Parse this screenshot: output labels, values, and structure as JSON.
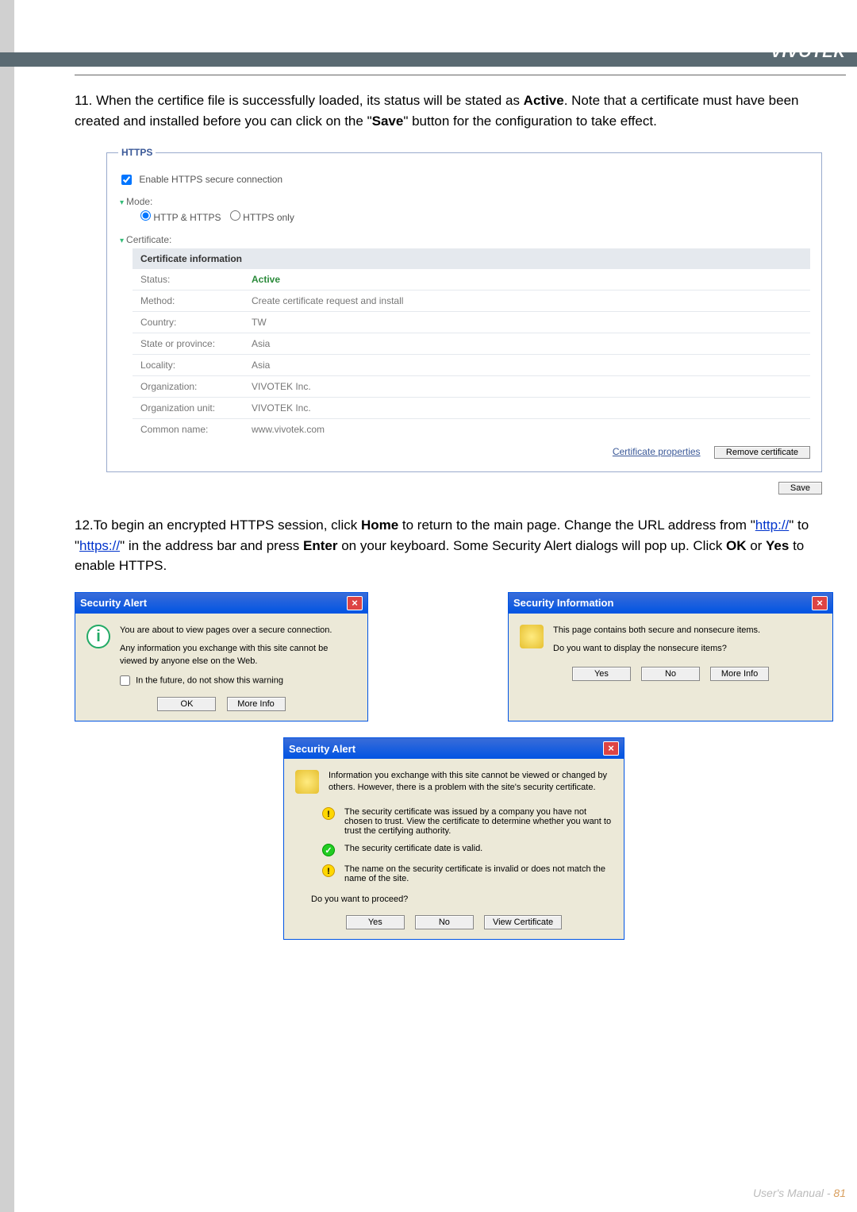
{
  "brand": "VIVOTEK",
  "step11": {
    "prefix": "11. When the certifice file is successfully loaded, its status will be stated as ",
    "active": "Active",
    "mid": ". Note that a certificate must have been created and installed before you can click on the \"",
    "save": "Save",
    "suffix": "\" button for the configuration to take effect."
  },
  "https_panel": {
    "legend": "HTTPS",
    "enable_label": "Enable HTTPS secure connection",
    "mode_label": "Mode:",
    "mode_opt1": "HTTP & HTTPS",
    "mode_opt2": "HTTPS only",
    "cert_label": "Certificate:",
    "certinfo_head": "Certificate information",
    "rows": [
      {
        "label": "Status:",
        "value": "Active",
        "active": true
      },
      {
        "label": "Method:",
        "value": "Create certificate request and install"
      },
      {
        "label": "Country:",
        "value": "TW"
      },
      {
        "label": "State or province:",
        "value": "Asia"
      },
      {
        "label": "Locality:",
        "value": "Asia"
      },
      {
        "label": "Organization:",
        "value": "VIVOTEK Inc."
      },
      {
        "label": "Organization unit:",
        "value": "VIVOTEK Inc."
      },
      {
        "label": "Common name:",
        "value": "www.vivotek.com"
      }
    ],
    "cert_props_link": "Certificate properties",
    "remove_btn": "Remove certificate",
    "save_btn": "Save"
  },
  "step12": {
    "prefix": "12.To begin an encrypted HTTPS session, click ",
    "home": "Home",
    "mid1": " to return to the main page. Change the URL address from \"",
    "http": "http://",
    "mid2": "\" to \"",
    "https": "https://",
    "mid3": "\" in the address bar and press ",
    "enter": "Enter",
    "mid4": " on your keyboard. Some Security Alert dialogs will pop up. Click ",
    "ok": "OK",
    "mid5": " or ",
    "yes": "Yes",
    "suffix": " to enable HTTPS."
  },
  "dialog1": {
    "title": "Security Alert",
    "line1": "You are about to view pages over a secure connection.",
    "line2": "Any information you exchange with this site cannot be viewed by anyone else on the Web.",
    "check": "In the future, do not show this warning",
    "ok": "OK",
    "more": "More Info"
  },
  "dialog2": {
    "title": "Security Information",
    "line1": "This page contains both secure and nonsecure items.",
    "line2": "Do you want to display the nonsecure items?",
    "yes": "Yes",
    "no": "No",
    "more": "More Info"
  },
  "dialog3": {
    "title": "Security Alert",
    "intro": "Information you exchange with this site cannot be viewed or changed by others. However, there is a problem with the site's security certificate.",
    "item1": "The security certificate was issued by a company you have not chosen to trust. View the certificate to determine whether you want to trust the certifying authority.",
    "item2": "The security certificate date is valid.",
    "item3": "The name on the security certificate is invalid or does not match the name of the site.",
    "question": "Do you want to proceed?",
    "yes": "Yes",
    "no": "No",
    "view": "View Certificate"
  },
  "footer": {
    "text": "User's Manual - ",
    "page": "81"
  }
}
